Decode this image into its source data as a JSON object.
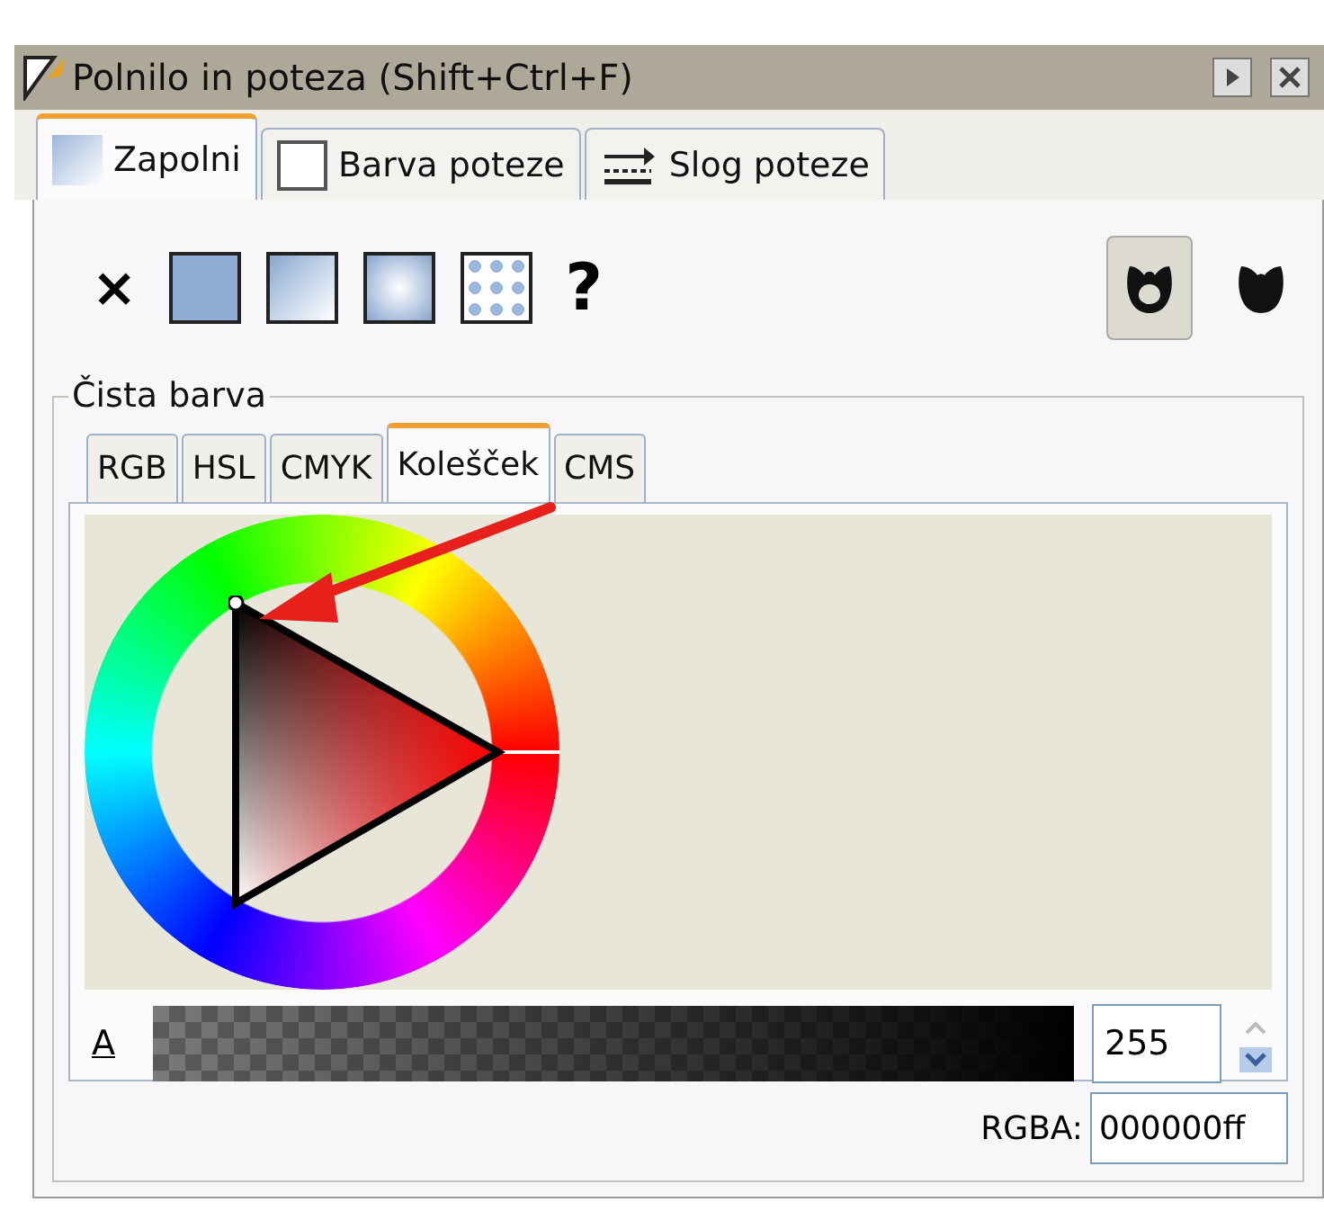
{
  "window": {
    "title": "Polnilo in poteza  (Shift+Ctrl+F)"
  },
  "tabs": [
    {
      "label": "Zapolni",
      "kind": "fill",
      "selected": true
    },
    {
      "label": "Barva poteze",
      "kind": "stroke",
      "selected": false
    },
    {
      "label": "Slog poteze",
      "kind": "style",
      "selected": false
    }
  ],
  "fill_types": [
    {
      "kind": "none",
      "label": "×"
    },
    {
      "kind": "flat"
    },
    {
      "kind": "linear"
    },
    {
      "kind": "radial"
    },
    {
      "kind": "pattern"
    },
    {
      "kind": "unset",
      "label": "?"
    }
  ],
  "fill_rules": [
    {
      "kind": "evenodd",
      "selected": true
    },
    {
      "kind": "nonzero",
      "selected": false
    }
  ],
  "section": {
    "title": "Čista barva"
  },
  "color_tabs": [
    {
      "label": "RGB",
      "selected": false
    },
    {
      "label": "HSL",
      "selected": false
    },
    {
      "label": "CMYK",
      "selected": false
    },
    {
      "label": "Kolešček",
      "selected": true
    },
    {
      "label": "CMS",
      "selected": false
    }
  ],
  "alpha": {
    "label": "A",
    "level": 1,
    "value": "255"
  },
  "rgba": {
    "label": "RGBA:",
    "value": "000000ff"
  }
}
